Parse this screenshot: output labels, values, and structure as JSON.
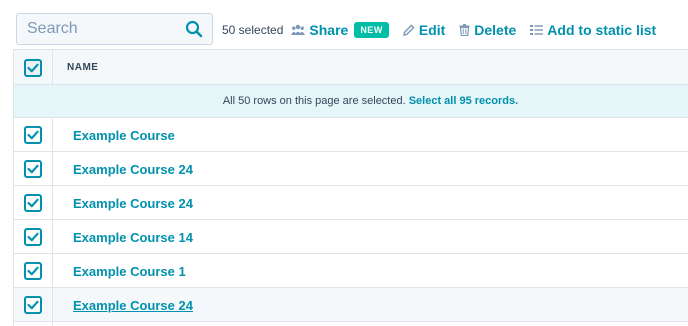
{
  "search": {
    "placeholder": "Search",
    "value": ""
  },
  "toolbar": {
    "selected_count": "50 selected",
    "share_label": "Share",
    "new_badge": "NEW",
    "edit_label": "Edit",
    "delete_label": "Delete",
    "add_to_list_label": "Add to static list"
  },
  "table": {
    "column_name": "NAME",
    "banner_text": "All 50 rows on this page are selected.",
    "banner_link": "Select all 95 records.",
    "rows": [
      {
        "name": "Example Course",
        "checked": true
      },
      {
        "name": "Example Course 24",
        "checked": true
      },
      {
        "name": "Example Course 24",
        "checked": true
      },
      {
        "name": "Example Course 14",
        "checked": true
      },
      {
        "name": "Example Course 1",
        "checked": true
      },
      {
        "name": "Example Course 24",
        "checked": true
      }
    ]
  },
  "colors": {
    "accent": "#0091ae",
    "badge": "#00bda5",
    "text": "#33475b",
    "banner_bg": "#e5f5f8"
  },
  "icons": [
    "search-icon",
    "share-icon",
    "pencil-icon",
    "trash-icon",
    "list-icon",
    "checkmark-icon"
  ]
}
